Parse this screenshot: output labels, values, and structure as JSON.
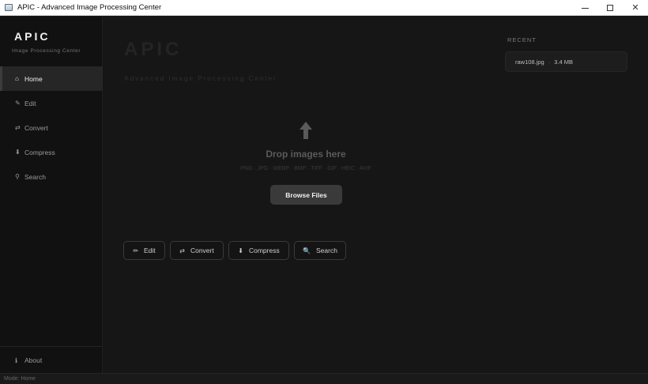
{
  "window": {
    "title": "APIC - Advanced Image Processing Center"
  },
  "sidebar": {
    "brand": "APIC",
    "brand_sub": "Image Processing Center",
    "items": [
      {
        "icon": "home-icon",
        "glyph": "⌂",
        "label": "Home",
        "active": true
      },
      {
        "icon": "edit-icon",
        "glyph": "✎",
        "label": "Edit",
        "active": false
      },
      {
        "icon": "convert-icon",
        "glyph": "⇄",
        "label": "Convert",
        "active": false
      },
      {
        "icon": "compress-icon",
        "glyph": "⬇",
        "label": "Compress",
        "active": false
      },
      {
        "icon": "search-icon",
        "glyph": "⚲",
        "label": "Search",
        "active": false
      }
    ],
    "about": {
      "icon": "info-icon",
      "glyph": "ℹ",
      "label": "About"
    }
  },
  "main": {
    "title": "APIC",
    "subtitle": "Advanced Image Processing Center",
    "drop": {
      "title": "Drop images here",
      "formats": "PNG · JPG · WEBP · BMP · TIFF · GIF · HEIC · AVIF",
      "browse_label": "Browse Files"
    },
    "actions": [
      {
        "icon": "edit-icon",
        "glyph": "✏",
        "label": "Edit"
      },
      {
        "icon": "convert-icon",
        "glyph": "⇄",
        "label": "Convert"
      },
      {
        "icon": "compress-icon",
        "glyph": "⬇",
        "label": "Compress"
      },
      {
        "icon": "search-icon",
        "glyph": "🔍",
        "label": "Search"
      }
    ]
  },
  "recent": {
    "heading": "RECENT",
    "items": [
      {
        "name": "raw108.jpg",
        "size": "3.4 MB"
      }
    ]
  },
  "status": {
    "text": "Mode: Home"
  },
  "colors": {
    "background": "#161616",
    "sidebar": "#111111",
    "accent_button": "#3a3a3a"
  }
}
